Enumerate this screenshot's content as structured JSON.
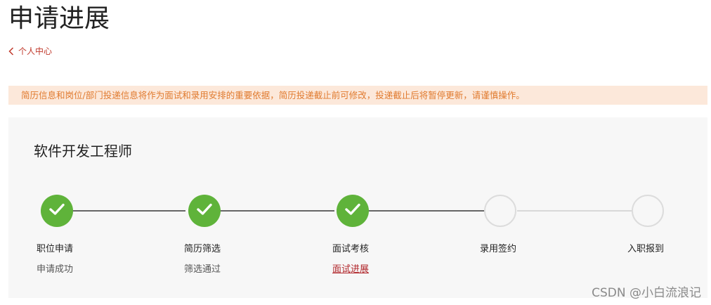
{
  "page": {
    "title": "申请进展",
    "back_link": "个人中心"
  },
  "notice": "简历信息和岗位/部门投递信息将作为面试和录用安排的重要依据，简历投递截止前可修改，投递截止后将暂停更新，请谨慎操作。",
  "card": {
    "job_title": "软件开发工程师",
    "steps": [
      {
        "label": "职位申请",
        "status": "申请成功",
        "state": "done"
      },
      {
        "label": "简历筛选",
        "status": "筛选通过",
        "state": "done"
      },
      {
        "label": "面试考核",
        "status": "面试进展",
        "state": "done"
      },
      {
        "label": "录用签约",
        "status": "",
        "state": "todo"
      },
      {
        "label": "入职报到",
        "status": "",
        "state": "todo"
      }
    ]
  },
  "watermark": "CSDN @小白流浪记",
  "colors": {
    "done": "#5fb33a",
    "accent": "#b0252a",
    "notice_bg": "#fce8da",
    "notice_text": "#e07a2e"
  },
  "icons": {
    "back": "chevron-left-icon",
    "done": "check-icon"
  }
}
